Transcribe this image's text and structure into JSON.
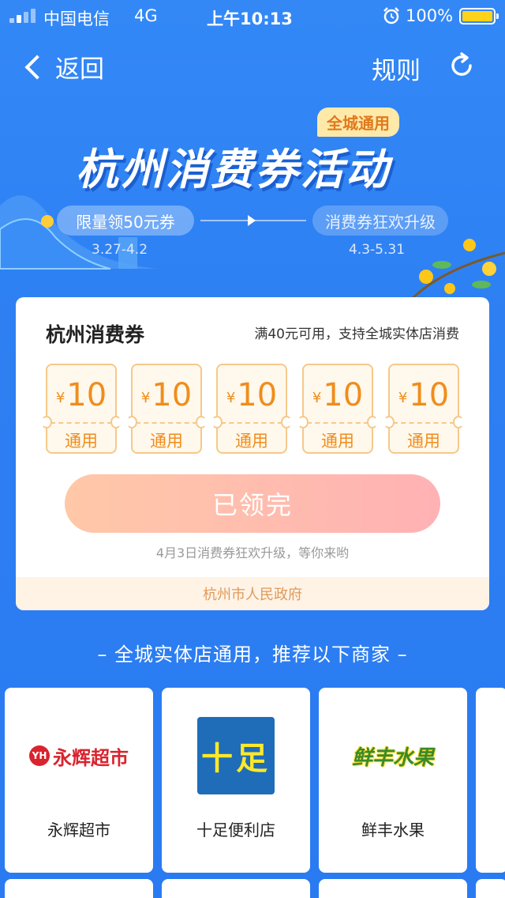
{
  "status_bar": {
    "carrier": "中国电信",
    "network": "4G",
    "time": "上午10:13",
    "battery_percent": "100%",
    "colors": {
      "battery": "#ffd21a"
    }
  },
  "nav": {
    "back_label": "返回",
    "rules_label": "规则",
    "icons": {
      "back": "chevron-left-icon",
      "refresh": "refresh-icon"
    }
  },
  "hero": {
    "badge": "全城通用",
    "title": "杭州消费券活动",
    "phases": [
      {
        "label": "限量领50元券",
        "dates": "3.27-4.2"
      },
      {
        "label": "消费券狂欢升级",
        "dates": "4.3-5.31"
      }
    ]
  },
  "card": {
    "title": "杭州消费券",
    "description": "满40元可用，支持全城实体店消费",
    "coupons": [
      {
        "currency": "¥",
        "amount": "10",
        "tag": "通用"
      },
      {
        "currency": "¥",
        "amount": "10",
        "tag": "通用"
      },
      {
        "currency": "¥",
        "amount": "10",
        "tag": "通用"
      },
      {
        "currency": "¥",
        "amount": "10",
        "tag": "通用"
      },
      {
        "currency": "¥",
        "amount": "10",
        "tag": "通用"
      }
    ],
    "claim_button": "已领完",
    "note": "4月3日消费券狂欢升级，等你来哟",
    "issuer": "杭州市人民政府",
    "colors": {
      "accent": "#f08d1c",
      "button_start": "#ffc8a8",
      "button_end": "#ffb2b4"
    }
  },
  "section": {
    "title": "– 全城实体店通用，推荐以下商家 –"
  },
  "merchants": [
    {
      "name": "永辉超市",
      "logo_text": "永辉超市",
      "logo_badge": "YH"
    },
    {
      "name": "十足便利店",
      "logo_text": "十足"
    },
    {
      "name": "鲜丰水果",
      "logo_text": "鲜丰水果"
    }
  ],
  "colors": {
    "background": "#2f7ff2"
  }
}
